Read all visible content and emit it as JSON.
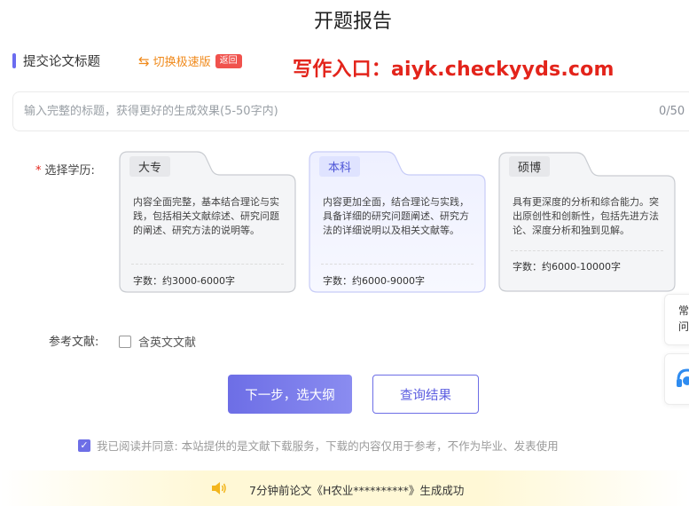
{
  "page": {
    "title": "开题报告"
  },
  "section": {
    "label": "提交论文标题"
  },
  "switch": {
    "label": "切换极速版",
    "badge": "返回",
    "icon": "swap-arrows-icon"
  },
  "promo": {
    "text": "写作入口：aiyk.checkyyds.com"
  },
  "title_input": {
    "placeholder": "输入完整的标题，获得更好的生成效果(5-50字内)",
    "value": "",
    "counter": "0/50"
  },
  "education": {
    "required_mark": "*",
    "label": "选择学历:",
    "options": [
      {
        "name": "大专",
        "desc": "内容全面完整，基本结合理论与实践，包括相关文献综述、研究问题的阐述、研究方法的说明等。",
        "count": "字数：约3000-6000字",
        "selected": false
      },
      {
        "name": "本科",
        "desc": "内容更加全面，结合理论与实践，具备详细的研究问题阐述、研究方法的详细说明以及相关文献等。",
        "count": "字数：约6000-9000字",
        "selected": true
      },
      {
        "name": "硕博",
        "desc": "具有更深度的分析和综合能力。突出原创性和创新性，包括先进方法论、深度分析和独到见解。",
        "count": "字数：约6000-10000字",
        "selected": false
      }
    ]
  },
  "reference": {
    "label": "参考文献:",
    "checkbox_label": "含英文文献",
    "checked": false
  },
  "buttons": {
    "next": "下一步，选大纲",
    "query": "查询结果"
  },
  "agreement": {
    "text": "我已阅读并同意: 本站提供的是文献下载服务，下载的内容仅用于参考，不作为毕业、发表使用",
    "checked": true
  },
  "notice": {
    "icon": "speaker-icon",
    "text": "7分钟前论文《H农业**********》生成成功"
  },
  "float": {
    "line1": "常",
    "line2": "问",
    "service_icon": "headset-icon"
  },
  "colors": {
    "accent": "#6b6cf0",
    "promo": "#e3241b",
    "switch": "#f08a1c",
    "badge": "#f0524d"
  }
}
